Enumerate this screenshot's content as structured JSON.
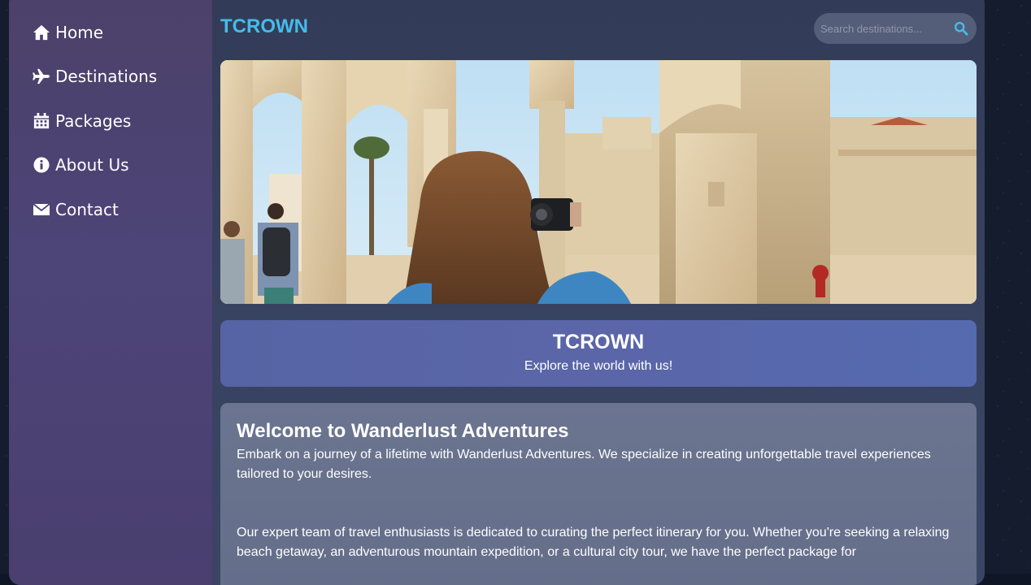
{
  "nav": {
    "items": [
      {
        "label": "Home",
        "icon": "home-icon"
      },
      {
        "label": "Destinations",
        "icon": "plane-icon"
      },
      {
        "label": "Packages",
        "icon": "calendar-icon"
      },
      {
        "label": "About Us",
        "icon": "info-circle-icon"
      },
      {
        "label": "Contact",
        "icon": "envelope-icon"
      }
    ]
  },
  "header": {
    "brand": "TCROWN",
    "search_placeholder": "Search destinations...",
    "search_icon": "search-icon"
  },
  "hero": {
    "image_alt": "Traveler photographing ancient stone arches"
  },
  "banner": {
    "title": "TCROWN",
    "subtitle": "Explore the world with us!"
  },
  "welcome": {
    "heading": "Welcome to Wanderlust Adventures",
    "paragraphs": [
      "Embark on a journey of a lifetime with Wanderlust Adventures. We specialize in creating unforgettable travel experiences tailored to your desires.",
      "Our expert team of travel enthusiasts is dedicated to curating the perfect itinerary for you. Whether you're seeking a relaxing beach getaway, an adventurous mountain expedition, or a cultural city tour, we have the perfect package for"
    ]
  },
  "colors": {
    "brand": "#45bcea",
    "sidebar": "#4d4478",
    "banner": "#5a66a8",
    "content_bg": "#384261"
  }
}
